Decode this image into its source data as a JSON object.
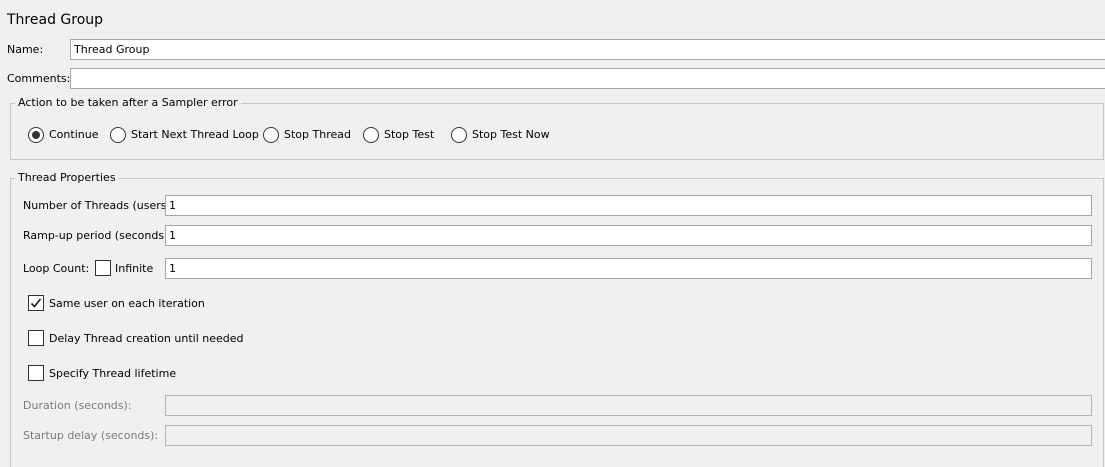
{
  "panel": {
    "title": "Thread Group",
    "name_label": "Name:",
    "name_value": "Thread Group",
    "comments_label": "Comments:",
    "comments_value": ""
  },
  "sampler_error": {
    "legend": "Action to be taken after a Sampler error",
    "options": [
      {
        "label": "Continue",
        "selected": true
      },
      {
        "label": "Start Next Thread Loop",
        "selected": false
      },
      {
        "label": "Stop Thread",
        "selected": false
      },
      {
        "label": "Stop Test",
        "selected": false
      },
      {
        "label": "Stop Test Now",
        "selected": false
      }
    ]
  },
  "thread_properties": {
    "legend": "Thread Properties",
    "num_threads_label": "Number of Threads (users):",
    "num_threads_value": "1",
    "rampup_label": "Ramp-up period (seconds):",
    "rampup_value": "1",
    "loop_count_label": "Loop Count:",
    "infinite_label": "Infinite",
    "infinite_checked": false,
    "loop_count_value": "1",
    "same_user_label": "Same user on each iteration",
    "same_user_checked": true,
    "delay_creation_label": "Delay Thread creation until needed",
    "delay_creation_checked": false,
    "specify_lifetime_label": "Specify Thread lifetime",
    "specify_lifetime_checked": false,
    "duration_label": "Duration (seconds):",
    "duration_value": "",
    "startup_delay_label": "Startup delay (seconds):",
    "startup_delay_value": ""
  },
  "colors": {
    "background": "#f0f0f0",
    "field_border": "#a5a5a5",
    "group_border": "#c6c6c6",
    "disabled_text": "#7a7a7a"
  }
}
